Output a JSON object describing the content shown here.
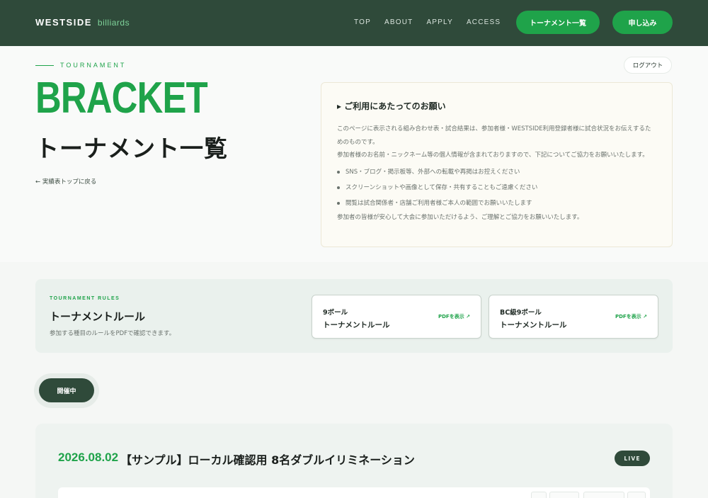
{
  "header": {
    "brand_main": "WESTSIDE",
    "brand_sub": "billiards",
    "nav": [
      "TOP",
      "ABOUT",
      "APPLY",
      "ACCESS"
    ],
    "tournament_list_button": "トーナメント一覧",
    "apply_button": "申し込み"
  },
  "hero": {
    "eyebrow": "TOURNAMENT",
    "title_en": "BRACKET",
    "title_jp": "トーナメント一覧",
    "back_link": "← 実績表トップに戻る",
    "logout": "ログアウト"
  },
  "notice": {
    "title": "▸ ご利用にあたってのお願い",
    "intro_1": "このページに表示される組み合わせ表・試合結果は、参加者様・WESTSIDE利用登録者様に試合状況をお伝えするためのものです。",
    "intro_2": "参加者様のお名前・ニックネーム等の個人情報が含まれておりますので、下記についてご協力をお願いいたします。",
    "bullets": [
      "SNS・ブログ・掲示板等、外部への転載や再掲はお控えください",
      "スクリーンショットや画像として保存・共有することもご遠慮ください",
      "閲覧は試合関係者・店舗ご利用者様ご本人の範囲でお願いいたします"
    ],
    "closing": "参加者の皆様が安心して大会に参加いただけるよう、ご理解とご協力をお願いいたします。"
  },
  "rules": {
    "eyebrow": "TOURNAMENT RULES",
    "title": "トーナメントルール",
    "description": "参加する種目のルールをPDFで確認できます。",
    "cards": [
      {
        "line1": "9ボール",
        "line2": "トーナメントルール",
        "pdf": "PDFを表示 ↗"
      },
      {
        "line1": "BC級9ボール",
        "line2": "トーナメントルール",
        "pdf": "PDFを表示 ↗"
      }
    ]
  },
  "status_pill": "開催中",
  "tournament": {
    "date": "2026.08.02",
    "name": "【サンプル】ローカル確認用 8名ダブルイリミネーション",
    "live": "LIVE"
  },
  "colors": {
    "header_bg": "#2f4a3a",
    "accent_green": "#1fa34a",
    "page_bg": "#f5f7f5"
  }
}
